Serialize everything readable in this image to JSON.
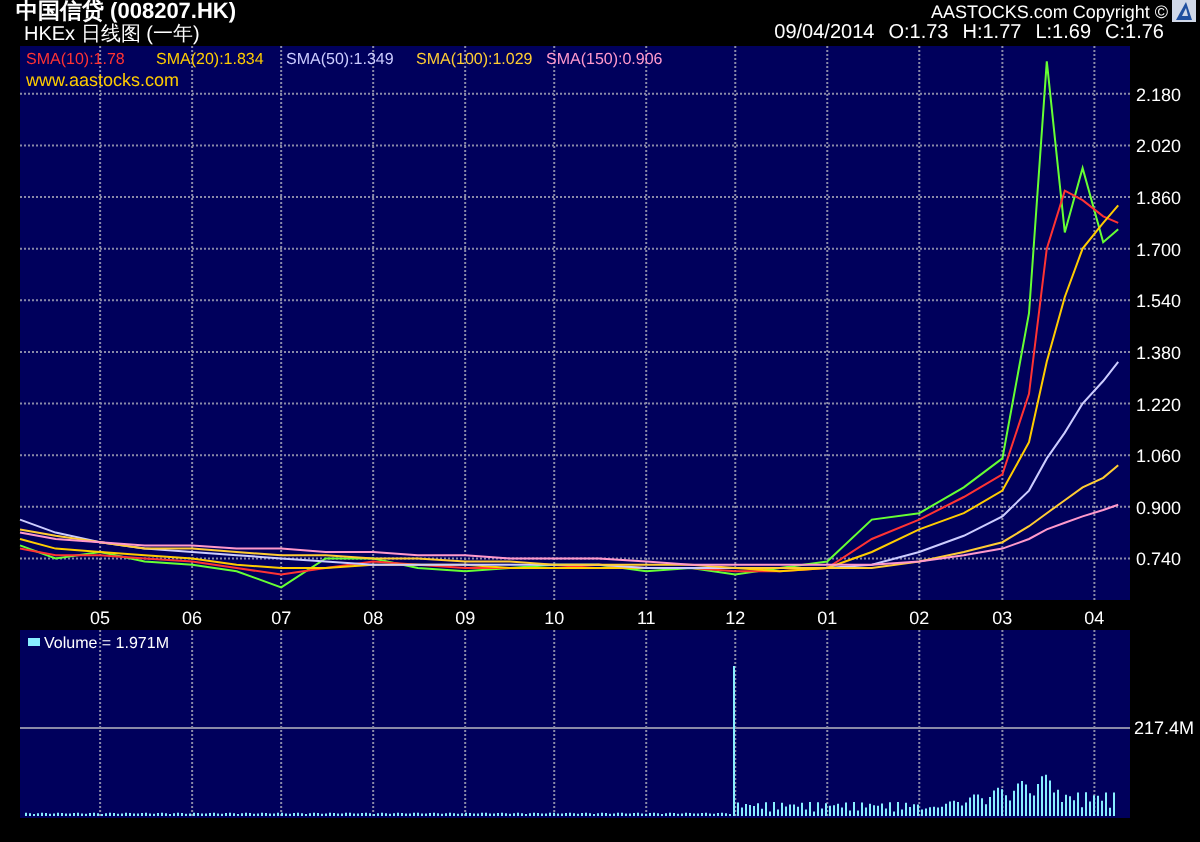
{
  "header": {
    "title": "中国信贷 (008207.HK)",
    "subtitle": "HKEx 日线图 (一年)",
    "copyright": "AASTOCKS.com Copyright ©",
    "date": "09/04/2014",
    "quote": [
      "O:1.73",
      "H:1.77",
      "L:1.69",
      "C:1.76"
    ]
  },
  "price_chart": {
    "legend": [
      {
        "text": "SMA(10):1.78",
        "color": "#ff3333"
      },
      {
        "text": "SMA(20):1.834",
        "color": "#ffcc00"
      },
      {
        "text": "SMA(50):1.349",
        "color": "#ccccff"
      },
      {
        "text": "SMA(100):1.029",
        "color": "#ffcc33"
      },
      {
        "text": "SMA(150):0.906",
        "color": "#ff99cc"
      }
    ],
    "website": "www.aastocks.com",
    "chart_data": {
      "type": "line",
      "x": [
        "2013-04-04",
        "2013-04-16",
        "2013-05-01",
        "2013-05-16",
        "2013-06-01",
        "2013-06-16",
        "2013-07-01",
        "2013-07-16",
        "2013-08-01",
        "2013-08-16",
        "2013-09-01",
        "2013-09-16",
        "2013-10-01",
        "2013-10-16",
        "2013-11-01",
        "2013-11-16",
        "2013-12-01",
        "2013-12-16",
        "2014-01-01",
        "2014-01-16",
        "2014-02-01",
        "2014-02-16",
        "2014-03-01",
        "2014-03-10",
        "2014-03-16",
        "2014-03-22",
        "2014-03-28",
        "2014-04-04",
        "2014-04-09"
      ],
      "series": [
        {
          "color": "#66ff33",
          "values": [
            0.78,
            0.74,
            0.76,
            0.73,
            0.72,
            0.7,
            0.65,
            0.74,
            0.74,
            0.71,
            0.7,
            0.71,
            0.72,
            0.72,
            0.7,
            0.71,
            0.69,
            0.71,
            0.73,
            0.86,
            0.88,
            0.96,
            1.05,
            1.5,
            2.28,
            1.75,
            1.95,
            1.72,
            1.76
          ]
        },
        {
          "color": "#ff3333",
          "values": [
            0.77,
            0.75,
            0.75,
            0.74,
            0.73,
            0.71,
            0.69,
            0.71,
            0.73,
            0.72,
            0.71,
            0.71,
            0.71,
            0.72,
            0.71,
            0.71,
            0.7,
            0.7,
            0.71,
            0.8,
            0.86,
            0.93,
            1.0,
            1.25,
            1.7,
            1.88,
            1.85,
            1.8,
            1.78
          ]
        },
        {
          "color": "#ffcc00",
          "values": [
            0.8,
            0.77,
            0.76,
            0.75,
            0.74,
            0.72,
            0.71,
            0.71,
            0.72,
            0.72,
            0.72,
            0.71,
            0.71,
            0.71,
            0.71,
            0.71,
            0.71,
            0.7,
            0.71,
            0.76,
            0.83,
            0.88,
            0.95,
            1.1,
            1.35,
            1.55,
            1.7,
            1.78,
            1.834
          ]
        },
        {
          "color": "#ccccff",
          "values": [
            0.86,
            0.82,
            0.79,
            0.77,
            0.76,
            0.75,
            0.74,
            0.73,
            0.72,
            0.72,
            0.72,
            0.72,
            0.72,
            0.72,
            0.71,
            0.71,
            0.71,
            0.71,
            0.71,
            0.72,
            0.76,
            0.81,
            0.87,
            0.95,
            1.05,
            1.13,
            1.22,
            1.29,
            1.349
          ]
        },
        {
          "color": "#ffcc33",
          "values": [
            0.83,
            0.81,
            0.79,
            0.77,
            0.77,
            0.76,
            0.75,
            0.75,
            0.74,
            0.74,
            0.73,
            0.73,
            0.72,
            0.72,
            0.72,
            0.72,
            0.71,
            0.71,
            0.71,
            0.71,
            0.73,
            0.76,
            0.79,
            0.84,
            0.88,
            0.92,
            0.96,
            0.99,
            1.029
          ]
        },
        {
          "color": "#ff99cc",
          "values": [
            0.82,
            0.8,
            0.79,
            0.78,
            0.78,
            0.77,
            0.77,
            0.76,
            0.76,
            0.75,
            0.75,
            0.74,
            0.74,
            0.74,
            0.73,
            0.72,
            0.72,
            0.72,
            0.72,
            0.72,
            0.73,
            0.75,
            0.77,
            0.8,
            0.83,
            0.85,
            0.87,
            0.89,
            0.906
          ]
        }
      ],
      "grid": true,
      "xlim": [
        "2013-04-04",
        "2014-04-13"
      ],
      "ylim": [
        0.611,
        2.328
      ],
      "xticks": [
        {
          "value": "2013-05-01",
          "label": "05"
        },
        {
          "value": "2013-06-01",
          "label": "06"
        },
        {
          "value": "2013-07-01",
          "label": "07"
        },
        {
          "value": "2013-08-01",
          "label": "08"
        },
        {
          "value": "2013-09-01",
          "label": "09"
        },
        {
          "value": "2013-10-01",
          "label": "10"
        },
        {
          "value": "2013-11-01",
          "label": "11"
        },
        {
          "value": "2013-12-01",
          "label": "12"
        },
        {
          "value": "2014-01-01",
          "label": "01"
        },
        {
          "value": "2014-02-01",
          "label": "02"
        },
        {
          "value": "2014-03-01",
          "label": "03"
        },
        {
          "value": "2014-04-01",
          "label": "04"
        }
      ],
      "yticks": [
        {
          "value": 0.74,
          "label": "0.740"
        },
        {
          "value": 0.9,
          "label": "0.900"
        },
        {
          "value": 1.06,
          "label": "1.060"
        },
        {
          "value": 1.22,
          "label": "1.220"
        },
        {
          "value": 1.38,
          "label": "1.380"
        },
        {
          "value": 1.54,
          "label": "1.540"
        },
        {
          "value": 1.7,
          "label": "1.700"
        },
        {
          "value": 1.86,
          "label": "1.860"
        },
        {
          "value": 2.02,
          "label": "2.020"
        },
        {
          "value": 2.18,
          "label": "2.180"
        }
      ]
    }
  },
  "volume_chart": {
    "legend": "Volume = 1.971M",
    "axis_label": "217.4M"
  }
}
